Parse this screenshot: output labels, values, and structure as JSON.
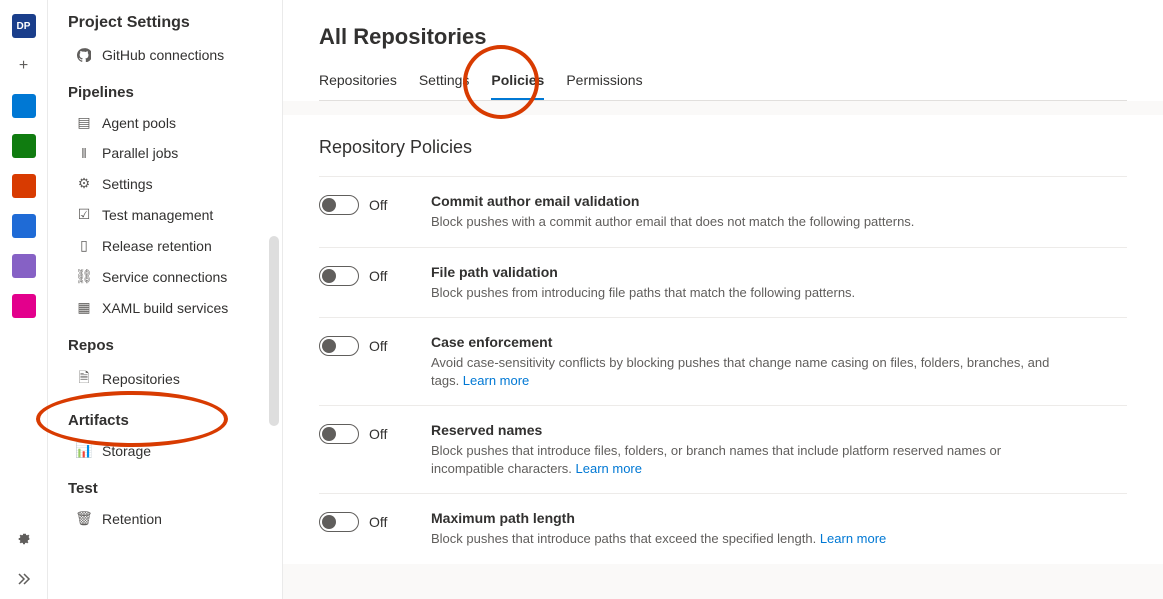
{
  "leftbar": {
    "badge": "DP",
    "items": [
      "plus",
      "boards",
      "tests",
      "repos",
      "pipes",
      "lab",
      "pkg"
    ]
  },
  "sidepanel": {
    "title": "Project Settings",
    "top_item": {
      "icon": "github",
      "label": "GitHub connections"
    },
    "groups": [
      {
        "label": "Pipelines",
        "items": [
          {
            "icon": "pool",
            "label": "Agent pools"
          },
          {
            "icon": "parallel",
            "label": "Parallel jobs"
          },
          {
            "icon": "gear",
            "label": "Settings"
          },
          {
            "icon": "test",
            "label": "Test management"
          },
          {
            "icon": "release",
            "label": "Release retention"
          },
          {
            "icon": "service",
            "label": "Service connections"
          },
          {
            "icon": "xaml",
            "label": "XAML build services"
          }
        ]
      },
      {
        "label": "Repos",
        "items": [
          {
            "icon": "repo",
            "label": "Repositories"
          }
        ]
      },
      {
        "label": "Artifacts",
        "items": [
          {
            "icon": "storage",
            "label": "Storage"
          }
        ]
      },
      {
        "label": "Test",
        "items": [
          {
            "icon": "retention",
            "label": "Retention"
          }
        ]
      }
    ]
  },
  "main": {
    "title": "All Repositories",
    "tabs": [
      "Repositories",
      "Settings",
      "Policies",
      "Permissions"
    ],
    "activeTab": "Policies",
    "panelTitle": "Repository Policies",
    "offLabel": "Off",
    "learnMore": "Learn more",
    "policies": [
      {
        "title": "Commit author email validation",
        "desc": "Block pushes with a commit author email that does not match the following patterns.",
        "learn": false
      },
      {
        "title": "File path validation",
        "desc": "Block pushes from introducing file paths that match the following patterns.",
        "learn": false
      },
      {
        "title": "Case enforcement",
        "desc": "Avoid case-sensitivity conflicts by blocking pushes that change name casing on files, folders, branches, and tags.",
        "learn": true
      },
      {
        "title": "Reserved names",
        "desc": "Block pushes that introduce files, folders, or branch names that include platform reserved names or incompatible characters.",
        "learn": true
      },
      {
        "title": "Maximum path length",
        "desc": "Block pushes that introduce paths that exceed the specified length.",
        "learn": true
      }
    ]
  }
}
